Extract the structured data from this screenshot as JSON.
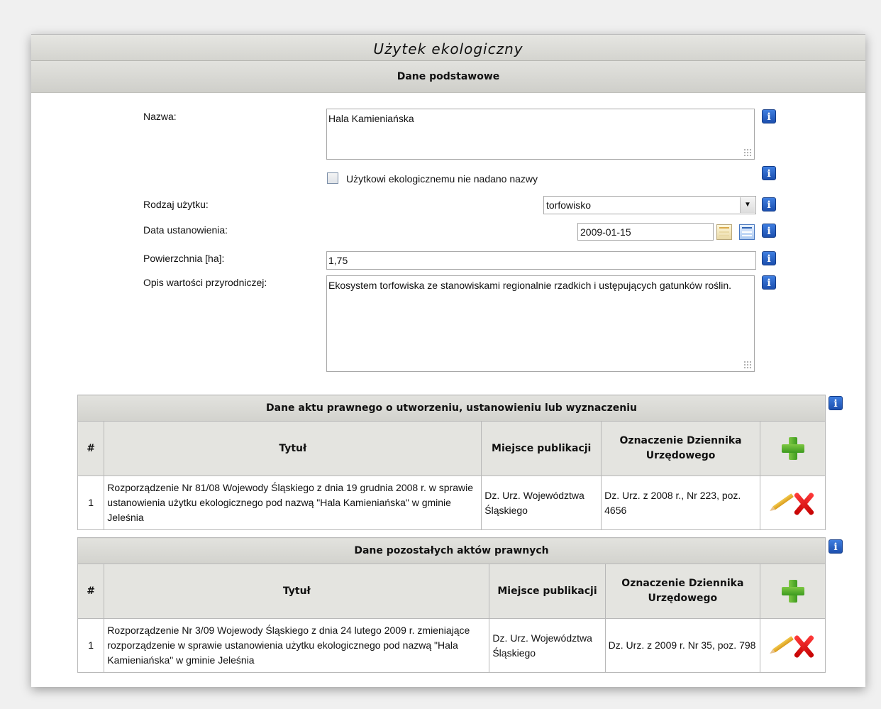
{
  "window_title": "Użytek ekologiczny",
  "section_title": "Dane podstawowe",
  "fields": {
    "name_label": "Nazwa:",
    "name_value": "Hala Kamieniańska",
    "no_name_label": "Użytkowi ekologicznemu nie nadano nazwy",
    "no_name_checked": false,
    "type_label": "Rodzaj użytku:",
    "type_value": "torfowisko",
    "date_label": "Data ustanowienia:",
    "date_value": "2009-01-15",
    "area_label": "Powierzchnia [ha]:",
    "area_value": "1,75",
    "desc_label": "Opis wartości przyrodniczej:",
    "desc_value": "Ekosystem torfowiska ze stanowiskami regionalnie rzadkich i ustępujących gatunków roślin."
  },
  "info_icon_glyph": "i",
  "table1": {
    "caption": "Dane aktu prawnego o utworzeniu, ustanowieniu lub wyznaczeniu",
    "columns": [
      "#",
      "Tytuł",
      "Miejsce publikacji",
      "Oznaczenie Dziennika Urzędowego"
    ],
    "rows": [
      {
        "num": "1",
        "title": "Rozporządzenie Nr 81/08 Wojewody Śląskiego z dnia 19 grudnia 2008 r. w sprawie ustanowienia użytku ekologicznego pod nazwą \"Hala Kamieniańska\" w gminie Jeleśnia",
        "place": "Dz. Urz. Województwa Śląskiego",
        "journal": "Dz. Urz. z 2008 r., Nr 223, poz. 4656"
      }
    ]
  },
  "table2": {
    "caption": "Dane pozostałych aktów prawnych",
    "columns": [
      "#",
      "Tytuł",
      "Miejsce publikacji",
      "Oznaczenie Dziennika Urzędowego"
    ],
    "rows": [
      {
        "num": "1",
        "title": "Rozporządzenie Nr 3/09 Wojewody Śląskiego z dnia 24 lutego 2009 r. zmieniające rozporządzenie w sprawie ustanowienia użytku ekologicznego pod nazwą \"Hala Kamieniańska\" w gminie Jeleśnia",
        "place": "Dz. Urz. Województwa Śląskiego",
        "journal": "Dz. Urz. z 2009 r. Nr 35, poz. 798"
      }
    ]
  },
  "icons": {
    "info": "info-icon",
    "add": "add-icon",
    "edit": "edit-pencil-icon",
    "delete": "delete-icon",
    "calendar": "calendar-icon",
    "dropdown": "chevron-down-icon"
  },
  "colors": {
    "info_blue": "#1c4fae",
    "add_green": "#3c9a1e",
    "delete_red": "#c40000",
    "header_gray": "#d4d4cf"
  }
}
